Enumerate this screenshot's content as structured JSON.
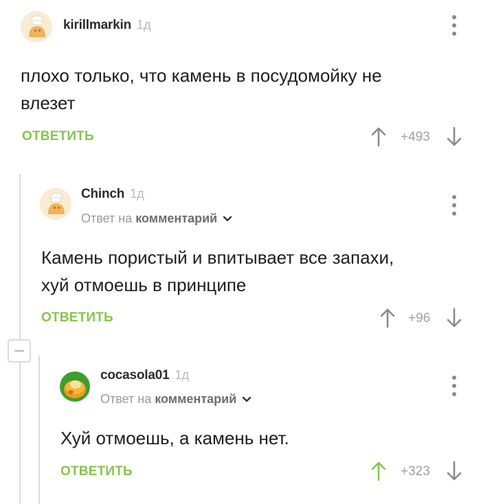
{
  "comments": [
    {
      "username": "kirillmarkin",
      "time": "1д",
      "text_line1": "плохо только, что камень в посудомойку не",
      "text_line2": "влезет",
      "reply_label": "ОТВЕТИТЬ",
      "score": "+493"
    },
    {
      "username": "Chinch",
      "time": "1д",
      "reply_prefix": "Ответ на ",
      "reply_target": "комментарий",
      "text_line1": "Камень пористый и впитывает все запахи,",
      "text_line2": "хуй отмоешь в принципе",
      "reply_label": "ОТВЕТИТЬ",
      "score": "+96"
    },
    {
      "username": "cocasola01",
      "time": "1д",
      "reply_prefix": "Ответ на ",
      "reply_target": "комментарий",
      "text_line1": "Хуй отмоешь, а камень нет.",
      "reply_label": "ОТВЕТИТЬ",
      "score": "+323"
    }
  ],
  "colors": {
    "accent_green": "#86c54c",
    "vote_gray": "#8a8a8a",
    "thread_line": "#dadada"
  },
  "icons": [
    "avatar-cook-icon",
    "avatar-bun-icon",
    "kebab-menu-icon",
    "upvote-arrow-icon",
    "downvote-arrow-icon",
    "chevron-down-icon",
    "collapse-thread-icon"
  ]
}
